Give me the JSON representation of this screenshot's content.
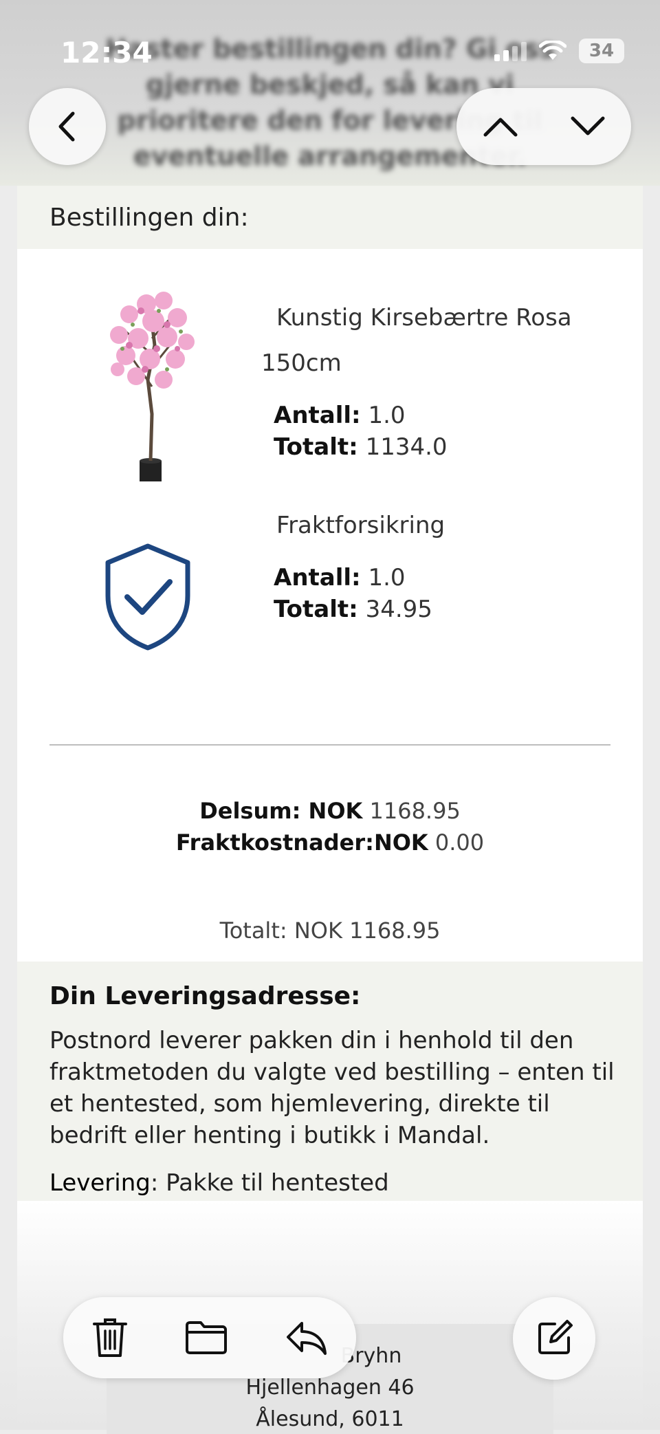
{
  "status_bar": {
    "time": "12:34",
    "battery": "34"
  },
  "blurred_header_text": "Haster bestillingen din? Gi oss gjerne beskjed, så kan vi prioritere den for levering til eventuelle arrangementer.",
  "order": {
    "header": "Bestillingen din:",
    "items": [
      {
        "name": "Kunstig Kirsebærtre Rosa",
        "size": "150cm",
        "qty_label": "Antall:",
        "qty": "1.0",
        "total_label": "Totalt:",
        "total": "1134.0"
      },
      {
        "name": "Fraktforsikring",
        "qty_label": "Antall:",
        "qty": "1.0",
        "total_label": "Totalt:",
        "total": "34.95"
      }
    ]
  },
  "summary": {
    "subtotal_label": "Delsum: NOK",
    "subtotal": "1168.95",
    "shipping_label": "Fraktkostnader:NOK",
    "shipping": "0.00",
    "total_text": "Totalt: NOK 1168.95"
  },
  "delivery": {
    "title": "Din Leveringsadresse:",
    "body": "Postnord leverer pakken din i henhold til den fraktmetoden du valgte ved bestilling – enten til et hentested, som hjemlevering, direkte til bedrift eller henting i butikk i Mandal.",
    "method_label": "Levering",
    "method": ": Pakke til hentested"
  },
  "address_card": {
    "name": "Bryhn",
    "street": "Hjellenhagen 46",
    "city": "Ålesund, 6011"
  },
  "icons": {
    "back": "chevron-left-icon",
    "prev": "chevron-up-icon",
    "next": "chevron-down-icon",
    "trash": "trash-icon",
    "folder": "folder-icon",
    "reply": "reply-icon",
    "compose": "compose-icon",
    "insurance": "shield-check-icon"
  },
  "colors": {
    "shield": "#1d4680",
    "panel": "#f2f3ee"
  }
}
